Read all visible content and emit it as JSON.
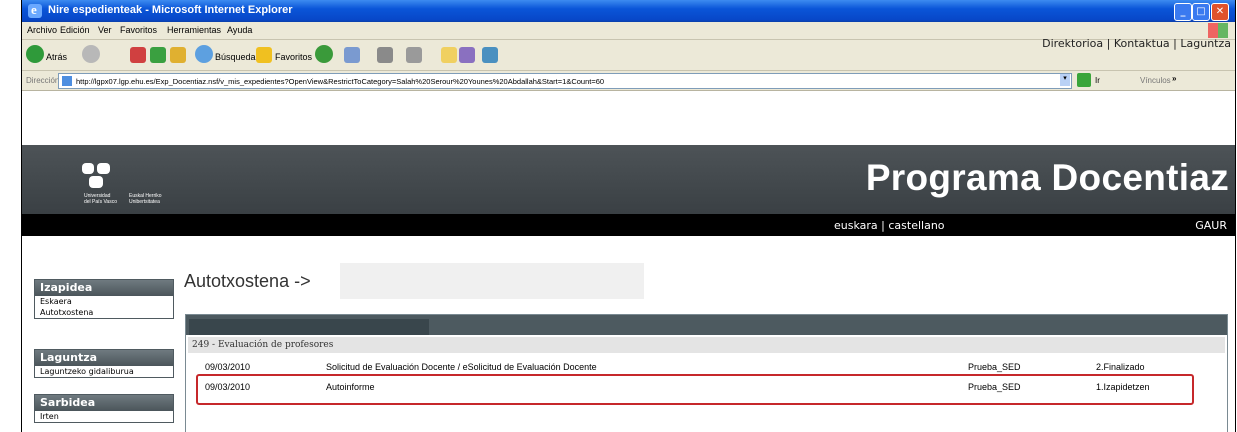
{
  "window": {
    "title": "Nire espedienteak - Microsoft Internet Explorer"
  },
  "menu": [
    "Archivo",
    "Edición",
    "Ver",
    "Favoritos",
    "Herramientas",
    "Ayuda"
  ],
  "toolbar": {
    "back_label": "Atrás",
    "search_label": "Búsqueda",
    "favorites_label": "Favoritos"
  },
  "address": {
    "label": "Dirección",
    "url": "http://lgpx07.lgp.ehu.es/Exp_Docentiaz.nsf/v_mis_expedientes?OpenView&RestrictToCategory=Salah%20Serour%20Younes%20Abdallah&Start=1&Count=60",
    "go_label": "Ir",
    "links_label": "Vínculos"
  },
  "page": {
    "top_links": [
      "Direktorioa",
      "Kontaktua",
      "Laguntza"
    ],
    "university": {
      "line1": "Universidad",
      "line2": "del País Vasco",
      "line3": "Euskal Herriko",
      "line4": "Unibertsitatea"
    },
    "banner_title": "Programa Docentiaz",
    "languages": [
      "euskara",
      "castellano"
    ],
    "gaur": "GAUR",
    "breadcrumb": "Autotxostena ->",
    "sidebar": [
      {
        "header": "Izapidea",
        "items": [
          "Eskaera",
          "Autotxostena"
        ]
      },
      {
        "header": "Laguntza",
        "items": [
          "Laguntzeko gidaliburua"
        ]
      },
      {
        "header": "Sarbidea",
        "items": [
          "Irten"
        ]
      }
    ],
    "group_title": "249 - Evaluación de profesores",
    "rows": [
      {
        "date": "09/03/2010",
        "description": "Solicitud de Evaluación Docente / eSolicitud de Evaluación Docente",
        "type": "Prueba_SED",
        "status": "2.Finalizado"
      },
      {
        "date": "09/03/2010",
        "description": "Autoinforme",
        "type": "Prueba_SED",
        "status": "1.Izapidetzen"
      }
    ]
  },
  "colors": {
    "highlight": "#c6282b",
    "banner": "#454b4f",
    "titlebar": "#0a55d8"
  }
}
